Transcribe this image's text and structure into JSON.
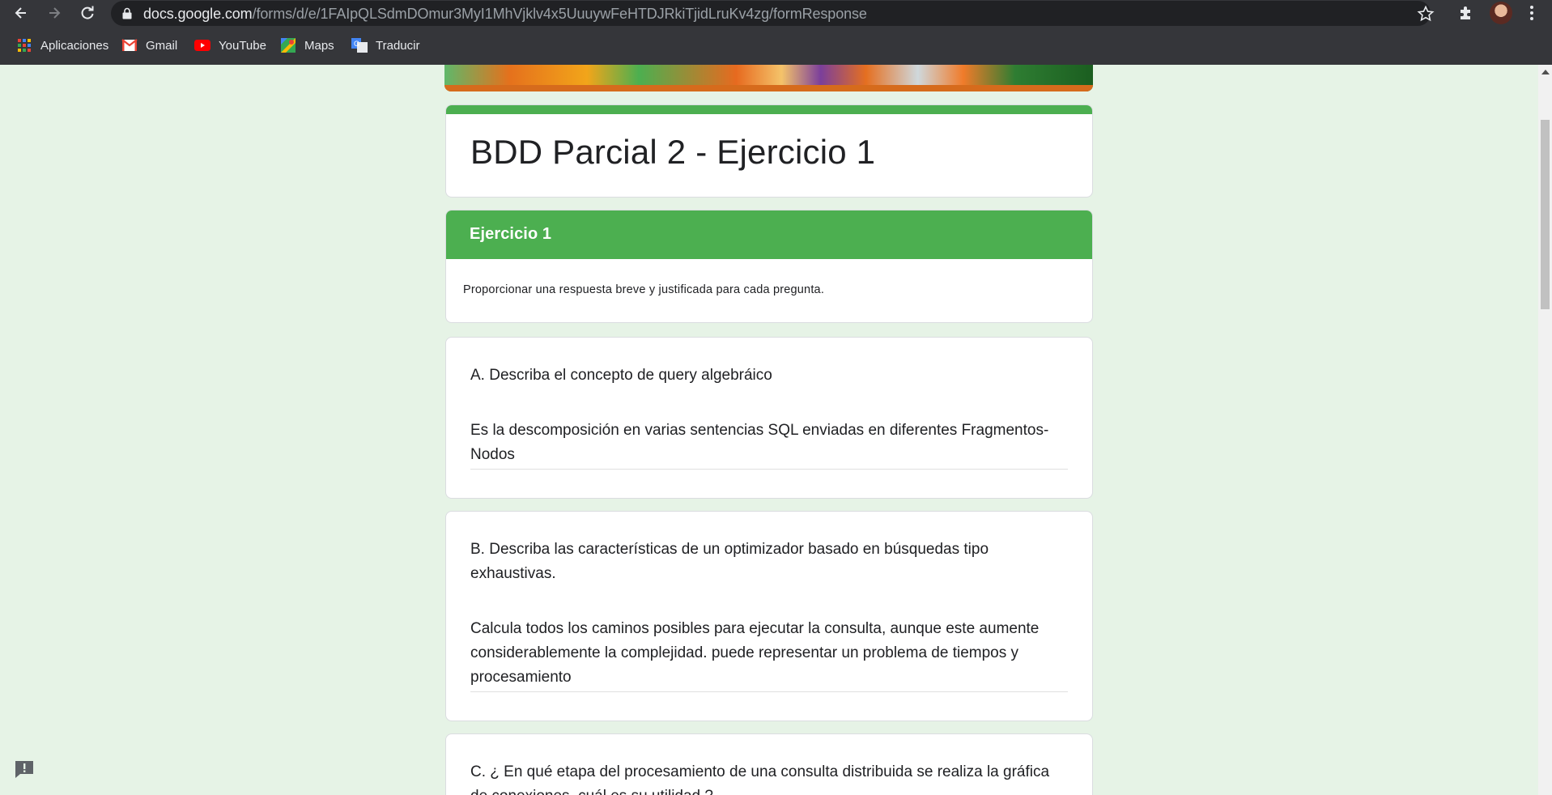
{
  "browser": {
    "url_host": "docs.google.com",
    "url_path": "/forms/d/e/1FAIpQLSdmDOmur3MyI1MhVjklv4x5UuuywFeHTDJRkiTjidLruKv4zg/formResponse",
    "bookmarks": [
      {
        "label": "Aplicaciones",
        "icon": "apps-grid-icon"
      },
      {
        "label": "Gmail",
        "icon": "gmail-icon"
      },
      {
        "label": "YouTube",
        "icon": "youtube-icon"
      },
      {
        "label": "Maps",
        "icon": "maps-icon"
      },
      {
        "label": "Traducir",
        "icon": "translate-icon"
      }
    ]
  },
  "form": {
    "title": "BDD Parcial 2 - Ejercicio 1",
    "accent_color": "#4caf50",
    "section": {
      "title": "Ejercicio 1",
      "description": "Proporcionar una respuesta breve y justificada para cada pregunta."
    },
    "questions": [
      {
        "text": "A. Describa el concepto de query algebráico",
        "answer": "Es la descomposición en varias sentencias SQL enviadas en diferentes Fragmentos-Nodos"
      },
      {
        "text": "B. Describa las características de un optimizador basado en búsquedas tipo exhaustivas.",
        "answer": "Calcula todos los caminos posibles para ejecutar la consulta, aunque este aumente considerablemente la complejidad. puede representar un problema de tiempos y procesamiento"
      },
      {
        "text": "C. ¿ En qué etapa del procesamiento de una consulta distribuida se realiza la gráfica de conexiones, cuál es su utilidad ?",
        "answer": ""
      }
    ]
  }
}
